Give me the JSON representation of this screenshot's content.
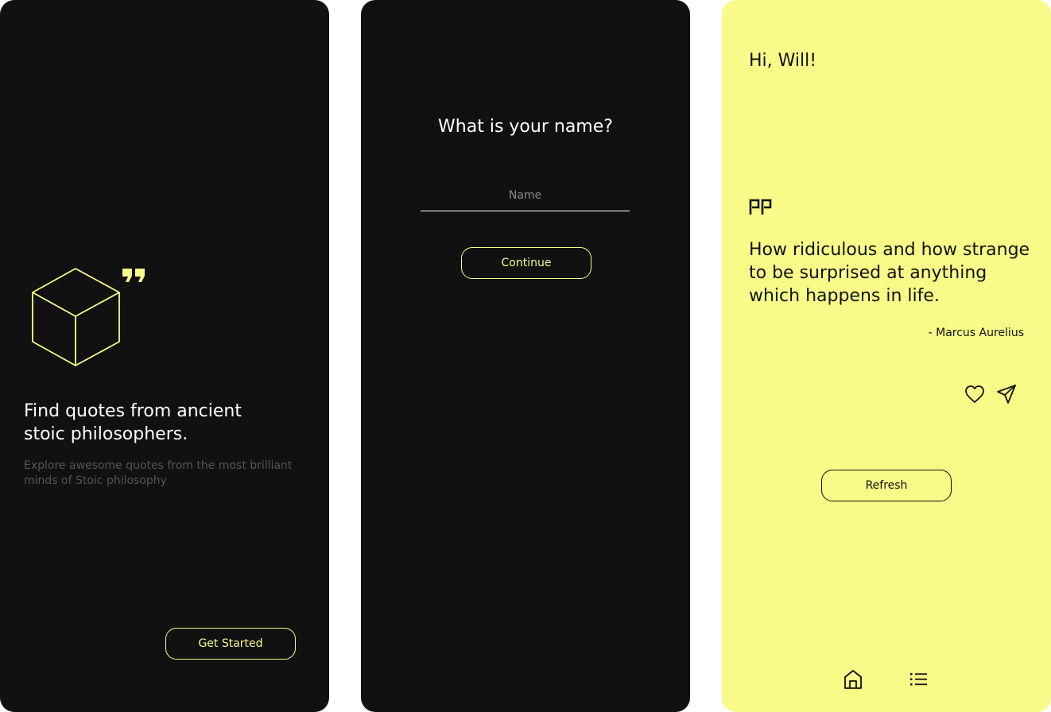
{
  "onboarding": {
    "title": "Find quotes from ancient stoic philosophers.",
    "subtitle": "Explore awesome quotes from the most brilliant minds of Stoic philosophy",
    "get_started_label": "Get Started",
    "icons": [
      "cube-icon",
      "quote-mark-icon"
    ]
  },
  "name_screen": {
    "title": "What is your name?",
    "name_placeholder": "Name",
    "name_value": "",
    "continue_label": "Continue"
  },
  "home": {
    "greeting": "Hi, Will!",
    "quote": "How ridiculous and how strange to be surprised at anything which happens in life.",
    "author": "- Marcus Aurelius",
    "refresh_label": "Refresh",
    "icons": [
      "quote-mark-icon",
      "heart-icon",
      "send-icon",
      "home-icon",
      "list-icon"
    ]
  },
  "colors": {
    "dark_bg": "#111111",
    "accent_yellow": "#f8fb87",
    "text_light": "#ffffff",
    "text_muted": "#555555"
  }
}
